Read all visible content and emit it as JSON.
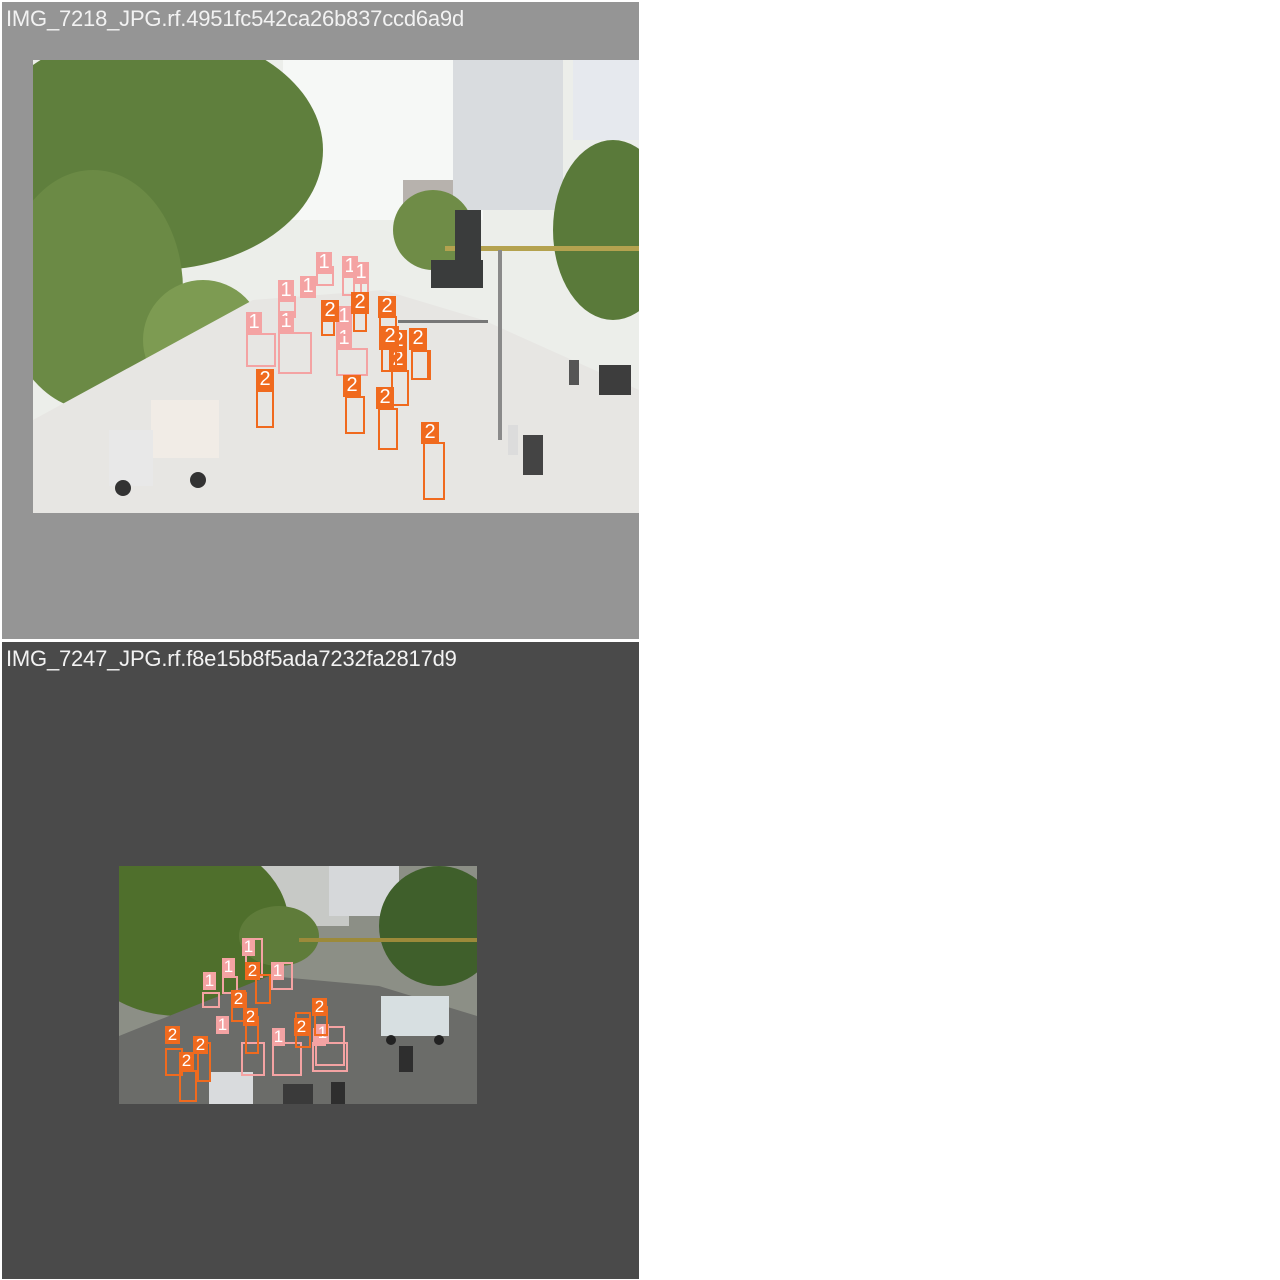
{
  "panels": [
    {
      "caption": "IMG_7218_JPG.rf.4951fc542ca26b837ccd6a9d",
      "background": "#959595"
    },
    {
      "caption": "IMG_7247_JPG.rf.f8e15b8f5ada7232fa2817d9",
      "background": "#4a4a4a"
    }
  ],
  "classes": {
    "1": {
      "label": "1",
      "color": "#f4a3a3"
    },
    "2": {
      "label": "2",
      "color": "#f06a1e"
    }
  }
}
